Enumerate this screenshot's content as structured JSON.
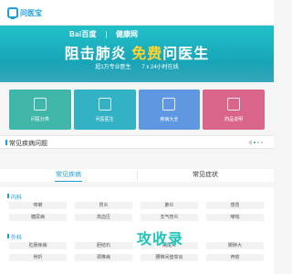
{
  "header": {
    "logo_text": "问医宝",
    "accent": "#1e9fd6"
  },
  "banner": {
    "partners": [
      "Bai百度",
      "健康网"
    ],
    "headline_part1": "阻击肺炎",
    "headline_free": "免费",
    "headline_part2": "问医生",
    "subline_1": "超1万专业医生",
    "subline_2": "7 x 24小时在线"
  },
  "features": [
    {
      "label": "问医分类",
      "icon": "grid-icon",
      "color": "#3fb6a7"
    },
    {
      "label": "问医医生",
      "icon": "doctor-icon",
      "color": "#33b2c6"
    },
    {
      "label": "疾病大全",
      "icon": "book-icon",
      "color": "#5f98e0"
    },
    {
      "label": "药品说明",
      "icon": "pill-icon",
      "color": "#d9658a"
    }
  ],
  "section": {
    "title": "常见疾病问题"
  },
  "tabs": [
    {
      "label": "常见疾病",
      "active": true
    },
    {
      "label": "常见症状",
      "active": false
    }
  ],
  "groups": [
    {
      "title": "内科",
      "items": [
        "咳嗽",
        "胃炎",
        "肺炎",
        "感冒",
        "糖尿病",
        "高血压",
        "支气管炎",
        "哮喘"
      ]
    },
    {
      "title": "外科",
      "items": [
        "肛肠疾病",
        "胆结石",
        "阑尾炎",
        "脚肿大",
        "骨折",
        "颈椎病",
        "腰椎间盘突出",
        "痔疮"
      ]
    }
  ],
  "watermark": "攻收录"
}
